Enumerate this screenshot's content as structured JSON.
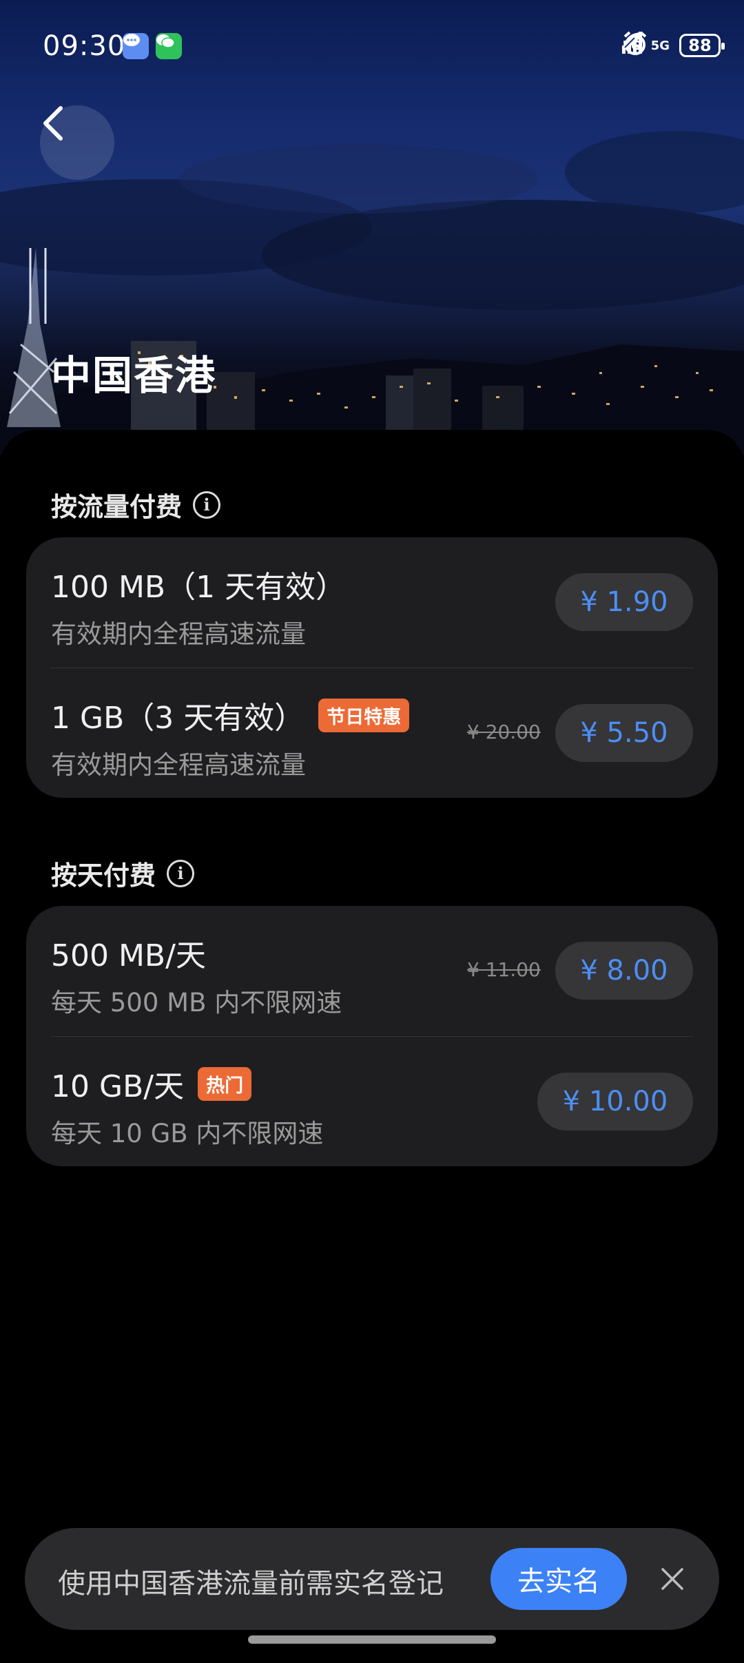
{
  "status_bar": {
    "time": "09:30",
    "notification_icons": [
      "message-icon",
      "wechat-icon"
    ],
    "network_1": "5G",
    "network_2": "5G",
    "battery": "88",
    "icons": [
      "alarm-icon",
      "signal-icon",
      "battery-icon",
      "leaf-icon"
    ]
  },
  "header": {
    "back_icon": "chevron-left-icon",
    "title": "中国香港"
  },
  "sections": [
    {
      "title": "按流量付费",
      "info_icon": "info-icon",
      "plans": [
        {
          "name": "100 MB（1 天有效）",
          "description": "有效期内全程高速流量",
          "badge": "",
          "original_price": "",
          "price": "¥ 1.90"
        },
        {
          "name": "1 GB（3 天有效）",
          "description": "有效期内全程高速流量",
          "badge": "节日特惠",
          "original_price": "¥ 20.00",
          "price": "¥ 5.50"
        }
      ]
    },
    {
      "title": "按天付费",
      "info_icon": "info-icon",
      "plans": [
        {
          "name": "500 MB/天",
          "description": "每天 500 MB 内不限网速",
          "badge": "",
          "original_price": "¥ 11.00",
          "price": "¥ 8.00"
        },
        {
          "name": "10 GB/天",
          "description": "每天 10 GB 内不限网速",
          "badge": "热门",
          "original_price": "",
          "price": "¥ 10.00"
        }
      ]
    }
  ],
  "banner": {
    "text": "使用中国香港流量前需实名登记",
    "button_label": "去实名",
    "close_icon": "close-icon"
  },
  "colors": {
    "accent": "#3c82f6",
    "price": "#4d8ef5",
    "badge": "#ec6a35",
    "card": "#1e1e20",
    "background": "#000000"
  }
}
